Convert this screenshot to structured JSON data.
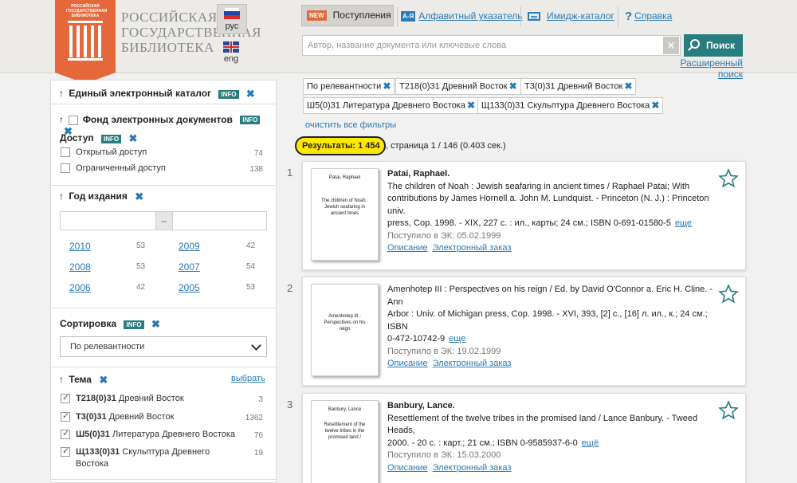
{
  "header": {
    "logo_small": "РОССИЙСКАЯ ГОСУДАРСТВЕННАЯ БИБЛИОТЕКА",
    "logo_lines": [
      "РОССИЙСКАЯ",
      "ГОСУДАРСТВЕННАЯ",
      "БИБЛИОТЕКА"
    ],
    "lang_ru": "рус",
    "lang_en": "eng",
    "nav": {
      "new_badge": "NEW",
      "new_label": "Поступления",
      "az_badge": "А-Я",
      "az_label": "Алфавитный указатель",
      "image_label": "Имидж-каталог",
      "help_label": "Справка"
    },
    "search": {
      "placeholder": "Автор, название документа или ключевые слова",
      "value": "",
      "button": "Поиск",
      "advanced": "Расширенный поиск"
    }
  },
  "sidebar": {
    "catalog": {
      "title": "Единый электронный каталог",
      "info": "INFO"
    },
    "fund": {
      "title": "Фонд электронных документов",
      "info": "INFO"
    },
    "access": {
      "title": "Доступ",
      "info": "INFO",
      "items": [
        {
          "label": "Открытый доступ",
          "count": "74"
        },
        {
          "label": "Ограниченный доступ",
          "count": "138"
        }
      ]
    },
    "year": {
      "title": "Год издания",
      "dash": "–",
      "from_value": "",
      "to_value": "",
      "years": [
        {
          "year": "2010",
          "count": "53"
        },
        {
          "year": "2009",
          "count": "42"
        },
        {
          "year": "2008",
          "count": "53"
        },
        {
          "year": "2007",
          "count": "54"
        },
        {
          "year": "2006",
          "count": "42"
        },
        {
          "year": "2005",
          "count": "53"
        }
      ]
    },
    "sort": {
      "title": "Сортировка",
      "info": "INFO",
      "selected": "По релевантности"
    },
    "topic": {
      "title": "Тема",
      "choose": "выбрать",
      "items": [
        {
          "code": "Т218(0)31",
          "label": "Древний Восток",
          "count": "3"
        },
        {
          "code": "Т3(0)31",
          "label": "Древний Восток",
          "count": "1362"
        },
        {
          "code": "Ш5(0)31",
          "label": "Литература Древнего Востока",
          "count": "76"
        },
        {
          "code": "Щ133(0)31",
          "label": "Скульптура Древнего",
          "label2": "Востока",
          "count": "19"
        }
      ]
    }
  },
  "filters": {
    "chips": [
      "По релевантности",
      "Т218(0)31 Древний Восток",
      "Т3(0)31 Древний Восток",
      "Ш5(0)31 Литература Древнего Востока",
      "Щ133(0)31 Скульптура Древнего Востока"
    ],
    "clear": "очистить все фильтры"
  },
  "results": {
    "summary": "Результаты: 1 454",
    "page_text": ", страница 1 / 146 (0.403 сек.)",
    "items": [
      {
        "num": "1",
        "thumb_author": "Patai, Raphael",
        "thumb_title": "The children of Noah : Jewish seafaring in ancient times",
        "author": "Patai, Raphael.",
        "lines": [
          "The children of Noah : Jewish seafaring in ancient times / Raphael Patai; With",
          "contributions by James Hornell a. John M. Lundquist. - Princeton (N. J.) : Princeton univ.",
          "press, Cop. 1998. - XIX, 227 c. : ил., карты; 24 см.; ISBN 0-691-01580-5"
        ],
        "more": "еще",
        "received": "Поступило в ЭК: 05.02.1999",
        "link_desc": "Описание",
        "link_order": "Электронный заказ"
      },
      {
        "num": "2",
        "thumb_author": "",
        "thumb_title": "Amenhotep III : Perspectives on his reign",
        "author": "",
        "lines": [
          "Amenhotep III : Perspectives on his reign / Ed. by David O'Connor a. Eric H. Cline. - Ann",
          "Arbor : Univ. of Michigan press, Cop. 1998. - XVI, 393, [2] c., [16] л. ил., к.; 24 см.; ISBN",
          "0-472-10742-9"
        ],
        "more": "еще",
        "received": "Поступило в ЭК: 19.02.1999",
        "link_desc": "Описание",
        "link_order": "Электронный заказ"
      },
      {
        "num": "3",
        "thumb_author": "Banbury, Lance",
        "thumb_title": "Resettlement of the twelve tribes in the promised land /",
        "author": "Banbury, Lance.",
        "lines": [
          "Resettlement of the twelve tribes in the promised land / Lance Banbury. - Tweed Heads,",
          "2000. - 20 c. : карт.; 21 см.; ISBN 0-9585937-6-0"
        ],
        "more": "ещё",
        "received": "Поступило в ЭК: 15.03.2000",
        "link_desc": "Описание",
        "link_order": "Электронный заказ"
      }
    ]
  },
  "icons": {
    "flag_ru": "flag-ru-icon",
    "flag_uk": "flag-uk-icon",
    "star": "star-icon",
    "info": "info-badge",
    "close": "close-icon"
  },
  "colors": {
    "accent": "#2a7d7f",
    "link": "#2a7ab5",
    "logo": "#e4683b",
    "highlight": "#ffe800"
  }
}
